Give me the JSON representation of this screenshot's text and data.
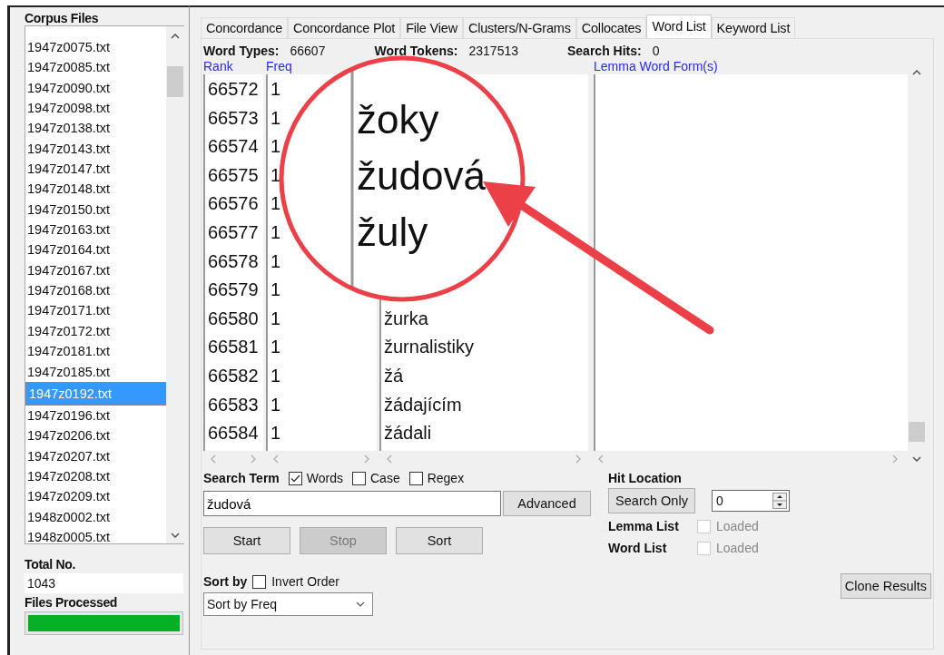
{
  "corpus_files": {
    "title": "Corpus Files",
    "items": [
      {
        "name": "1947z0075.txt",
        "selected": false
      },
      {
        "name": "1947z0085.txt",
        "selected": false
      },
      {
        "name": "1947z0090.txt",
        "selected": false
      },
      {
        "name": "1947z0098.txt",
        "selected": false
      },
      {
        "name": "1947z0138.txt",
        "selected": false
      },
      {
        "name": "1947z0143.txt",
        "selected": false
      },
      {
        "name": "1947z0147.txt",
        "selected": false
      },
      {
        "name": "1947z0148.txt",
        "selected": false
      },
      {
        "name": "1947z0150.txt",
        "selected": false
      },
      {
        "name": "1947z0163.txt",
        "selected": false
      },
      {
        "name": "1947z0164.txt",
        "selected": false
      },
      {
        "name": "1947z0167.txt",
        "selected": false
      },
      {
        "name": "1947z0168.txt",
        "selected": false
      },
      {
        "name": "1947z0171.txt",
        "selected": false
      },
      {
        "name": "1947z0172.txt",
        "selected": false
      },
      {
        "name": "1947z0181.txt",
        "selected": false
      },
      {
        "name": "1947z0185.txt",
        "selected": false
      },
      {
        "name": "1947z0192.txt",
        "selected": true
      },
      {
        "name": "1947z0196.txt",
        "selected": false
      },
      {
        "name": "1947z0206.txt",
        "selected": false
      },
      {
        "name": "1947z0207.txt",
        "selected": false
      },
      {
        "name": "1947z0208.txt",
        "selected": false
      },
      {
        "name": "1947z0209.txt",
        "selected": false
      },
      {
        "name": "1948z0002.txt",
        "selected": false
      },
      {
        "name": "1948z0005.txt",
        "selected": false
      }
    ],
    "total_label": "Total No.",
    "total": "1043",
    "processed_label": "Files Processed",
    "progress": {
      "level": 1
    }
  },
  "tabs": [
    {
      "label": "Concordance",
      "selected": false
    },
    {
      "label": "Concordance Plot",
      "selected": false
    },
    {
      "label": "File View",
      "selected": false
    },
    {
      "label": "Clusters/N-Grams",
      "selected": false
    },
    {
      "label": "Collocates",
      "selected": false
    },
    {
      "label": "Word List",
      "selected": true
    },
    {
      "label": "Keyword List",
      "selected": false
    }
  ],
  "stats": [
    {
      "label": "Word Types:",
      "value": "66607"
    },
    {
      "label": "Word Tokens:",
      "value": "2317513"
    },
    {
      "label": "Search Hits:",
      "value": "0"
    }
  ],
  "table": {
    "columns": [
      "Rank",
      "Freq",
      "Lemma Word Form(s)"
    ],
    "rows": [
      {
        "rank": "66572",
        "freq": "1"
      },
      {
        "rank": "66573",
        "freq": "1"
      },
      {
        "rank": "66574",
        "freq": "1"
      },
      {
        "rank": "66575",
        "freq": "1"
      },
      {
        "rank": "66576",
        "freq": "1"
      },
      {
        "rank": "66577",
        "freq": "1"
      },
      {
        "rank": "66578",
        "freq": "1"
      },
      {
        "rank": "66579",
        "freq": "1"
      },
      {
        "rank": "66580",
        "freq": "1",
        "word": "žurka"
      },
      {
        "rank": "66581",
        "freq": "1",
        "word": "žurnalistiky"
      },
      {
        "rank": "66582",
        "freq": "1",
        "word": "žá"
      },
      {
        "rank": "66583",
        "freq": "1",
        "word": "žádajícím"
      },
      {
        "rank": "66584",
        "freq": "1",
        "word": "žádali"
      }
    ]
  },
  "magnifier": {
    "words": [
      "žoky",
      "žudová",
      "žuly"
    ]
  },
  "search": {
    "label": "Search Term",
    "options": [
      {
        "label": "Words",
        "checked": true
      },
      {
        "label": "Case",
        "checked": false
      },
      {
        "label": "Regex",
        "checked": false
      }
    ],
    "value": "žudová",
    "advanced": "Advanced"
  },
  "buttons": [
    {
      "label": "Start",
      "disabled": false
    },
    {
      "label": "Stop",
      "disabled": true
    },
    {
      "label": "Sort",
      "disabled": false
    }
  ],
  "sort": {
    "label": "Sort by",
    "invert": {
      "label": "Invert Order",
      "checked": false
    },
    "value": "Sort by Freq"
  },
  "hit_location": {
    "label": "Hit Location",
    "button": "Search Only",
    "value": "0"
  },
  "loaded": [
    {
      "label": "Lemma List",
      "option": "Loaded",
      "checked": false,
      "disabled": true
    },
    {
      "label": "Word List",
      "option": "Loaded",
      "checked": false,
      "disabled": true
    }
  ],
  "clone": "Clone Results"
}
